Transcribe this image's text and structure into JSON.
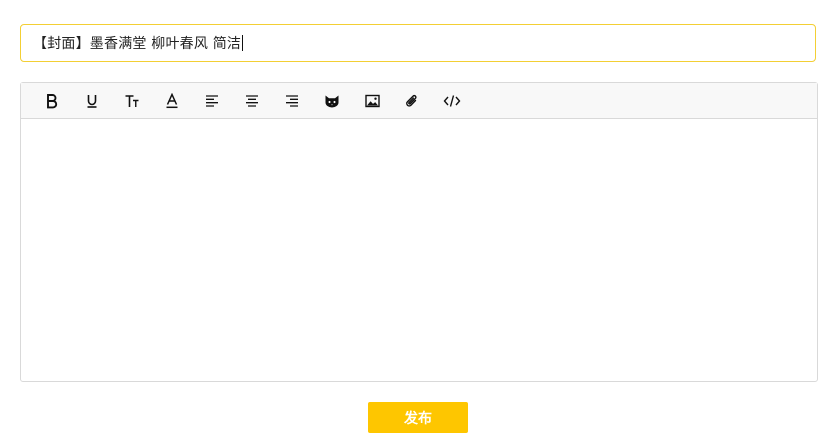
{
  "title_input": {
    "value": "【封面】墨香满堂 柳叶春风 简洁"
  },
  "toolbar": {
    "items": [
      {
        "icon": "bold-icon"
      },
      {
        "icon": "underline-icon"
      },
      {
        "icon": "font-size-icon"
      },
      {
        "icon": "font-color-icon"
      },
      {
        "icon": "align-left-icon"
      },
      {
        "icon": "align-center-icon"
      },
      {
        "icon": "align-right-icon"
      },
      {
        "icon": "emoji-cat-icon"
      },
      {
        "icon": "image-icon"
      },
      {
        "icon": "attachment-icon"
      },
      {
        "icon": "code-icon"
      }
    ]
  },
  "editor": {
    "content": ""
  },
  "publish_button": {
    "label": "发布"
  },
  "colors": {
    "accent": "#fec600",
    "input_border": "#f3cf34",
    "editor_border": "#d9d9d9",
    "toolbar_bg": "#f8f8f8"
  }
}
